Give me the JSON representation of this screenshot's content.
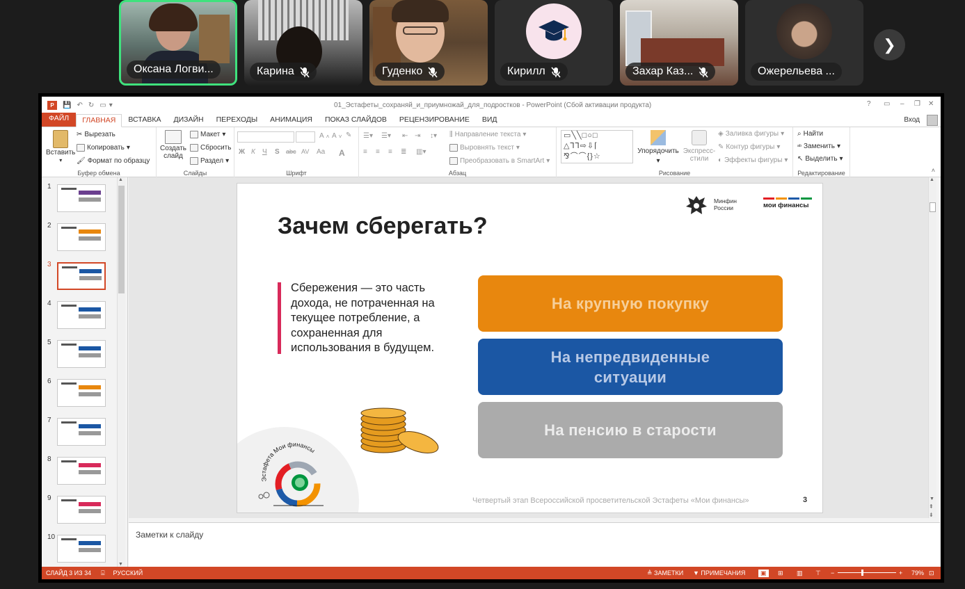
{
  "participants": [
    {
      "name": "Оксана Логви...",
      "muted": false
    },
    {
      "name": "Карина",
      "muted": true
    },
    {
      "name": "Гуденко",
      "muted": true
    },
    {
      "name": "Кирилл",
      "muted": true
    },
    {
      "name": "Захар Каз...",
      "muted": true
    },
    {
      "name": "Ожерельева ...",
      "muted": false
    }
  ],
  "next_icon": "chevron-right-icon",
  "ppt": {
    "window_title": "01_Эстафеты_сохраняй_и_приумножай_для_подростков - PowerPoint (Сбой активации продукта)",
    "title_controls": [
      "?",
      "▭",
      "–",
      "❐",
      "✕"
    ],
    "signin": "Вход",
    "tabs": [
      "ФАЙЛ",
      "ГЛАВНАЯ",
      "ВСТАВКА",
      "ДИЗАЙН",
      "ПЕРЕХОДЫ",
      "АНИМАЦИЯ",
      "ПОКАЗ СЛАЙДОВ",
      "РЕЦЕНЗИРОВАНИЕ",
      "ВИД"
    ],
    "ribbon": {
      "paste": "Вставить",
      "cut": "Вырезать",
      "copy": "Копировать",
      "format_painter": "Формат по образцу",
      "clipboard_group": "Буфер обмена",
      "new_slide": "Создать слайд",
      "layout": "Макет",
      "reset": "Сбросить",
      "section": "Раздел",
      "slides_group": "Слайды",
      "font_group": "Шрифт",
      "bold": "Ж",
      "italic": "К",
      "underline": "Ч",
      "shadow": "S",
      "strike": "abc",
      "spacing": "AV",
      "case": "Aa",
      "text_direction": "Направление текста",
      "align_text": "Выровнять текст",
      "smartart": "Преобразовать в SmartArt",
      "paragraph_group": "Абзац",
      "arrange": "Упорядочить",
      "quick_styles": "Экспресс-стили",
      "shape_fill": "Заливка фигуры",
      "shape_outline": "Контур фигуры",
      "shape_effects": "Эффекты фигуры",
      "drawing_group": "Рисование",
      "find": "Найти",
      "replace": "Заменить",
      "select": "Выделить",
      "editing_group": "Редактирование"
    },
    "thumbnails": [
      "1",
      "2",
      "3",
      "4",
      "5",
      "6",
      "7",
      "8",
      "9",
      "10"
    ],
    "selected_slide": 2,
    "slide": {
      "title": "Зачем сберегать?",
      "body": "Сбережения — это часть дохода, не потраченная на текущее потребление, а сохраненная для использования в будущем.",
      "cards": [
        {
          "label": "На крупную покупку",
          "color": "#e8870e",
          "text_color": "#f6cf9a"
        },
        {
          "label": "На непредвиденные ситуации",
          "color": "#1b57a4",
          "text_color": "#b8c9e6"
        },
        {
          "label": "На пенсию в старости",
          "color": "#ababab",
          "text_color": "#ececec"
        }
      ],
      "minfin_line1": "Минфин",
      "minfin_line2": "России",
      "moi_finansy": "мои финансы",
      "relay_text": "Эстафета Мои финансы",
      "footer": "Четвертый этап Всероссийской просветительской Эстафеты «Мои финансы»",
      "page_number": "3"
    },
    "notes_placeholder": "Заметки к слайду",
    "status": {
      "slide_count": "СЛАЙД 3 ИЗ 34",
      "language": "РУССКИЙ",
      "notes": "ЗАМЕТКИ",
      "comments": "ПРИМЕЧАНИЯ",
      "zoom": "79%",
      "zoom_fraction": 0.4
    }
  }
}
